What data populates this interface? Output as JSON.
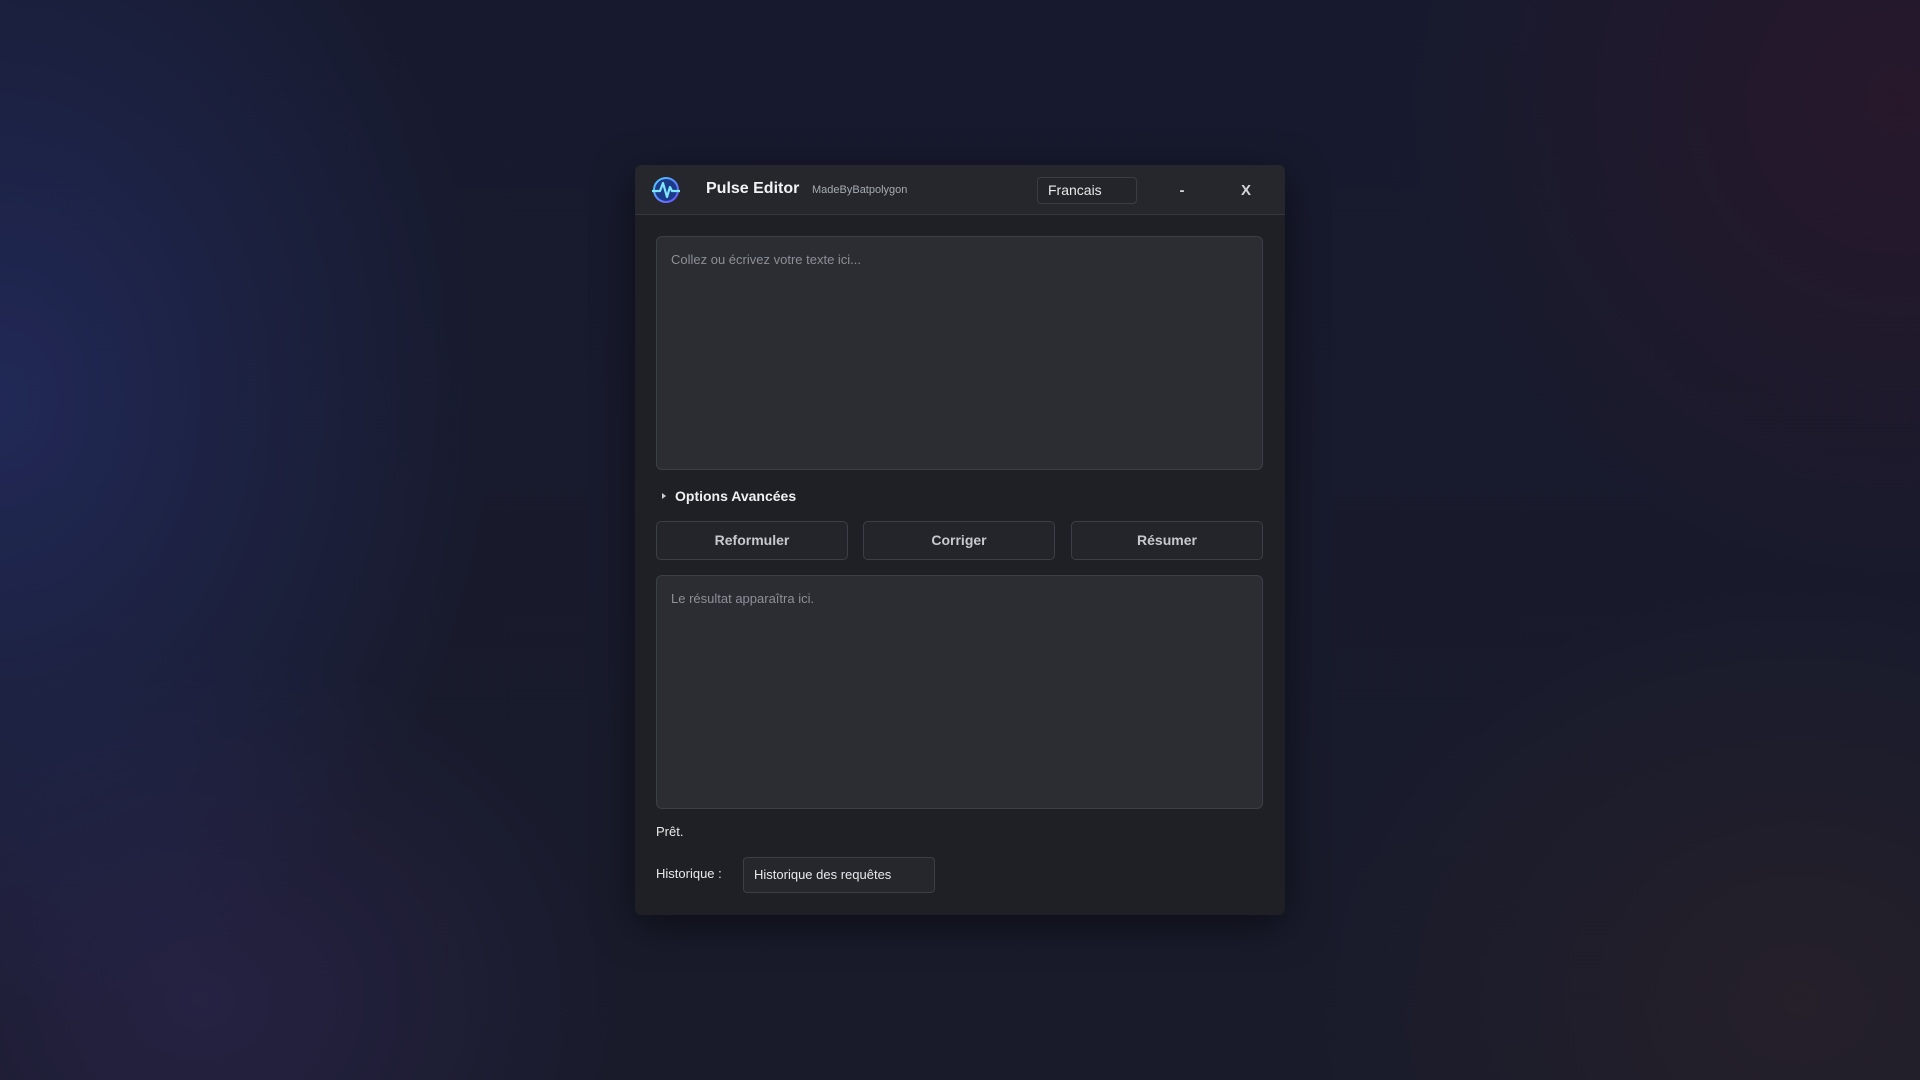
{
  "window": {
    "title": "Pulse Editor",
    "subtitle": "MadeByBatpolygon",
    "logo_icon": "pulse-logo",
    "language_select": {
      "selected": "Francais"
    },
    "minimize_label": "-",
    "close_label": "X"
  },
  "editor": {
    "input_placeholder": "Collez ou écrivez votre texte ici...",
    "advanced_options_label": "Options Avancées",
    "buttons": [
      {
        "label": "Reformuler"
      },
      {
        "label": "Corriger"
      },
      {
        "label": "Résumer"
      }
    ],
    "output_placeholder": "Le résultat apparaîtra ici."
  },
  "footer": {
    "status": "Prêt.",
    "history_label": "Historique :",
    "history_select": {
      "selected": "Historique des requêtes"
    }
  },
  "colors": {
    "window_bg": "#1e2025",
    "titlebar_bg": "#25272c",
    "textarea_bg": "#2b2d33",
    "border": "#3c3f46",
    "text_primary": "#f2f3f5",
    "placeholder": "#8d9097"
  }
}
